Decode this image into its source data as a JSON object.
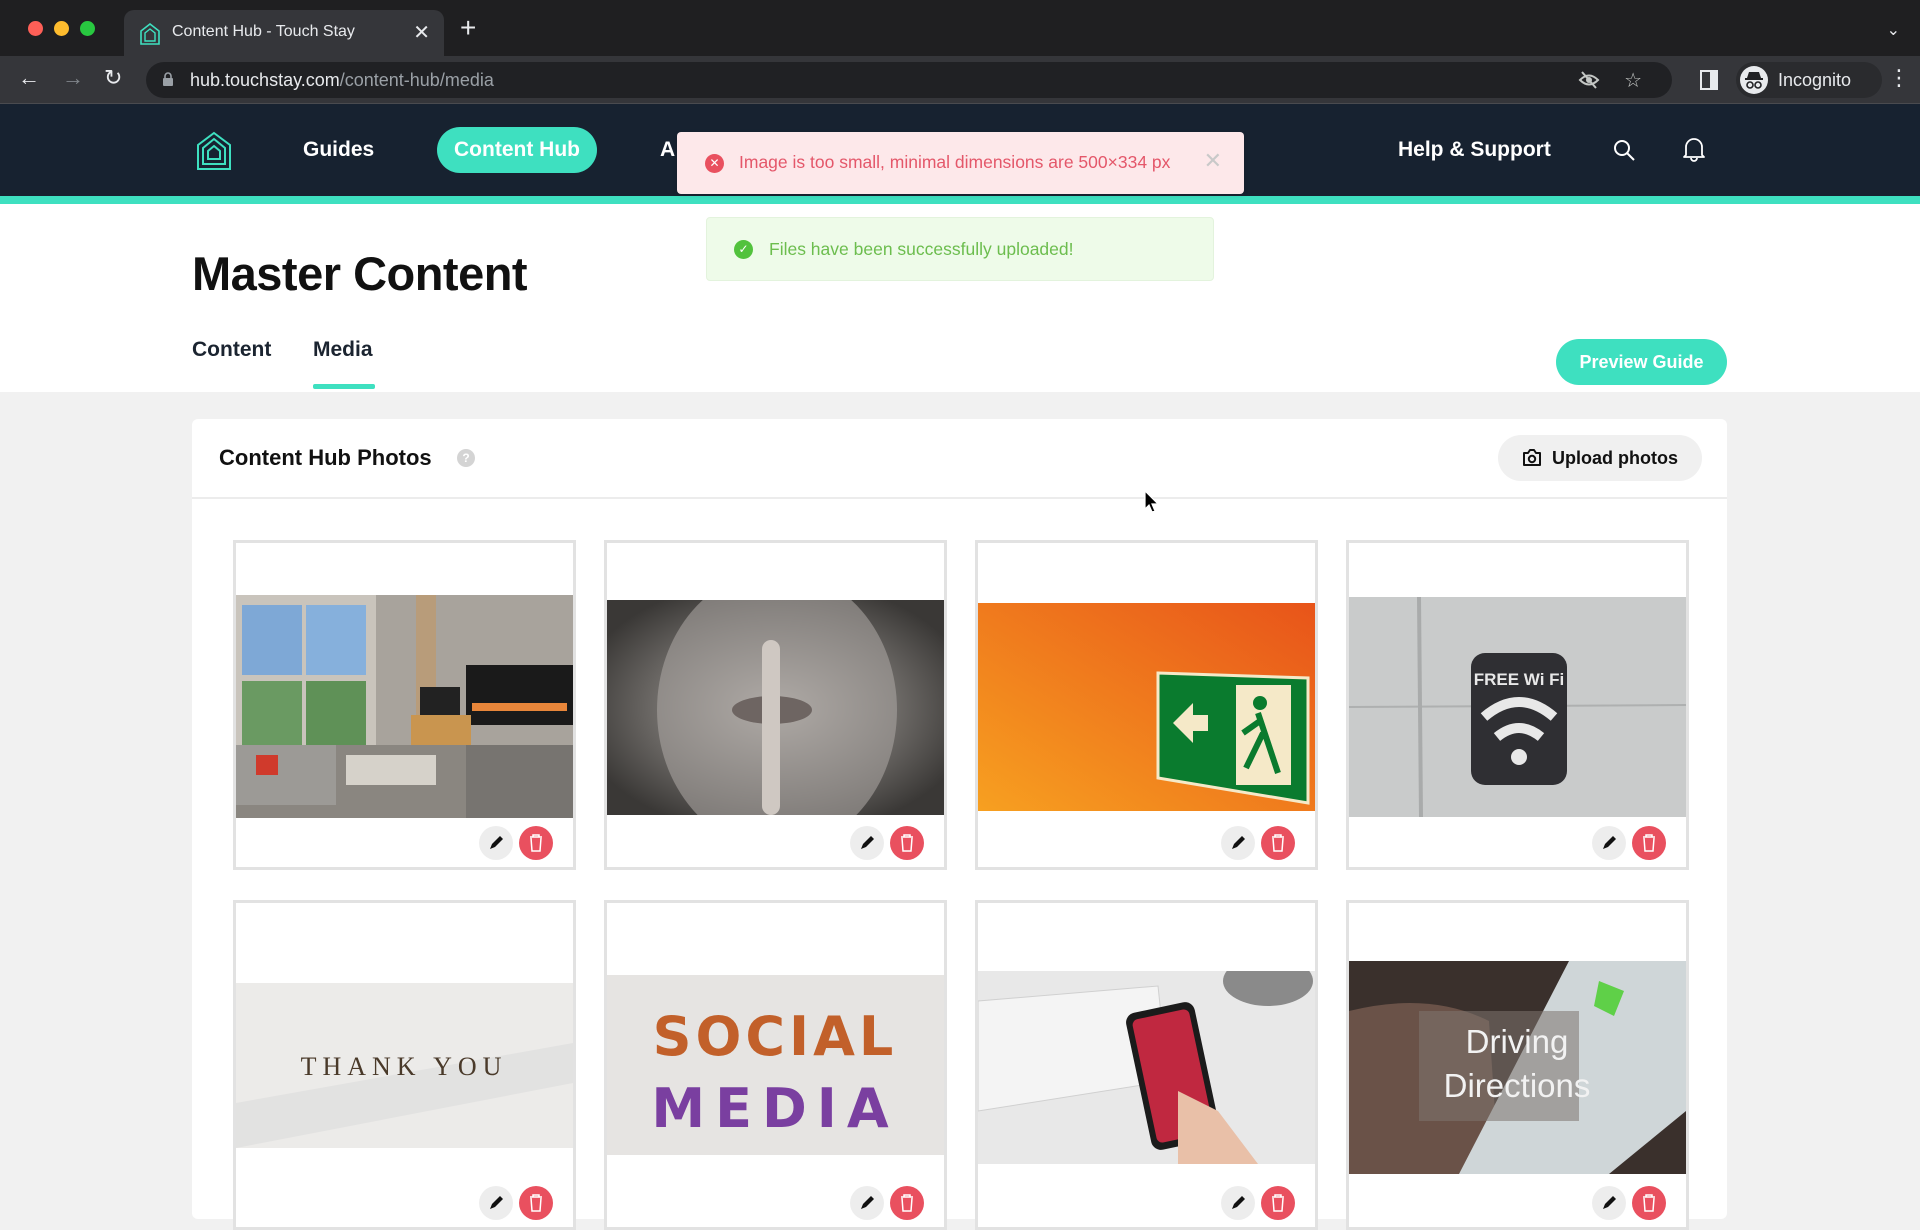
{
  "browser": {
    "tab_title": "Content Hub - Touch Stay",
    "url_host": "hub.touchstay.com",
    "url_path": "/content-hub/media",
    "profile_label": "Incognito"
  },
  "nav": {
    "items": [
      {
        "label": "Guides"
      },
      {
        "label": "Content Hub",
        "active": true
      },
      {
        "label": "A"
      }
    ],
    "help_label": "Help & Support"
  },
  "toasts": {
    "error": "Image is too small, minimal dimensions are 500×334 px",
    "success": "Files have been successfully uploaded!"
  },
  "page": {
    "title": "Master Content",
    "tabs": [
      {
        "label": "Content"
      },
      {
        "label": "Media",
        "active": true
      }
    ],
    "preview_label": "Preview Guide"
  },
  "panel": {
    "title": "Content Hub Photos",
    "help_glyph": "?",
    "upload_label": "Upload photos"
  },
  "photos": [
    {
      "subject": "living room with fireplace"
    },
    {
      "subject": "person shushing"
    },
    {
      "subject": "emergency exit sign"
    },
    {
      "subject": "free wifi sign",
      "text": "FREE Wi Fi"
    },
    {
      "subject": "thank you letter blocks",
      "text": "THANK YOU"
    },
    {
      "subject": "social media letters",
      "text": "SOCIAL MEDIA"
    },
    {
      "subject": "phone and keyboard"
    },
    {
      "subject": "driving directions map",
      "text": "Driving Directions"
    }
  ],
  "colors": {
    "accent": "#3ee0c0",
    "nav_bg": "#172230",
    "error": "#e9505f",
    "success": "#52c23d"
  }
}
